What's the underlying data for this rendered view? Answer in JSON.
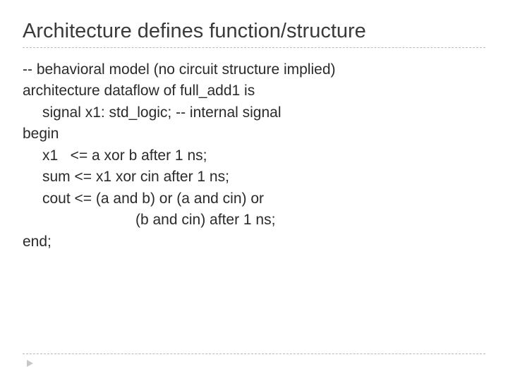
{
  "title": "Architecture defines function/structure",
  "code": {
    "line1": "-- behavioral model (no circuit structure implied)",
    "line2": "architecture dataflow of full_add1 is",
    "line3": "signal x1: std_logic; -- internal signal",
    "line4": "begin",
    "line5": "x1   <= a xor b after 1 ns;",
    "line6": "sum <= x1 xor cin after 1 ns;",
    "line7": "cout <= (a and b) or (a and cin) or",
    "line8": "(b and cin) after 1 ns;",
    "line9": "end;"
  }
}
